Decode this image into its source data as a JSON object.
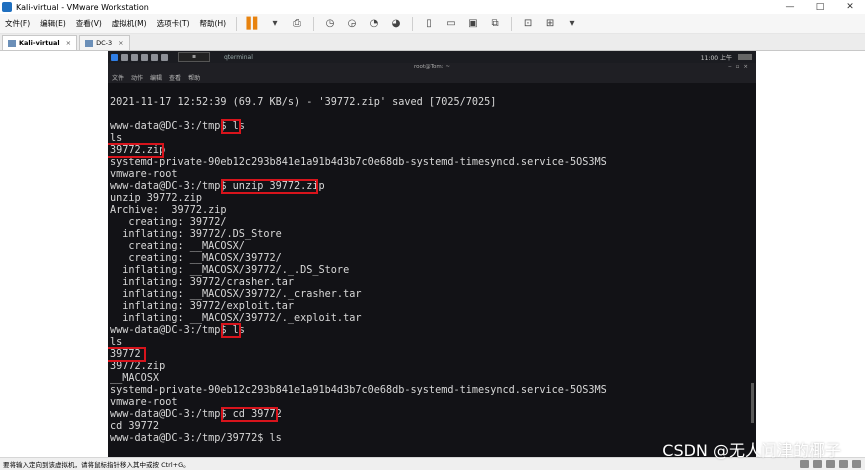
{
  "window": {
    "title": "Kali-virtual - VMware Workstation",
    "controls": [
      "—",
      "□",
      "✕"
    ]
  },
  "menubar": {
    "items": [
      "文件(F)",
      "编辑(E)",
      "查看(V)",
      "虚拟机(M)",
      "选项卡(T)",
      "帮助(H)"
    ]
  },
  "tabs": [
    {
      "label": "Kali-virtual",
      "active": true
    },
    {
      "label": "DC-3",
      "active": false
    }
  ],
  "guest": {
    "panel": {
      "terminal_tab": "qterminal",
      "clock": "11:00 上午"
    },
    "terminal_title": "root@Tom: ~",
    "terminal_menu": [
      "文件",
      "动作",
      "编辑",
      "查看",
      "帮助"
    ],
    "lines": [
      "2021-11-17 12:52:39 (69.7 KB/s) - '39772.zip' saved [7025/7025]",
      "",
      "www-data@DC-3:/tmp$ ls",
      "ls",
      "39772.zip",
      "systemd-private-90eb12c293b841e1a91b4d3b7c0e68db-systemd-timesyncd.service-5OS3MS",
      "vmware-root",
      "www-data@DC-3:/tmp$ unzip 39772.zip",
      "unzip 39772.zip",
      "Archive:  39772.zip",
      "   creating: 39772/",
      "  inflating: 39772/.DS_Store",
      "   creating: __MACOSX/",
      "   creating: __MACOSX/39772/",
      "  inflating: __MACOSX/39772/._.DS_Store",
      "  inflating: 39772/crasher.tar",
      "  inflating: __MACOSX/39772/._crasher.tar",
      "  inflating: 39772/exploit.tar",
      "  inflating: __MACOSX/39772/._exploit.tar",
      "www-data@DC-3:/tmp$ ls",
      "ls",
      "39772",
      "39772.zip",
      "__MACOSX",
      "systemd-private-90eb12c293b841e1a91b4d3b7c0e68db-systemd-timesyncd.service-5OS3MS",
      "vmware-root",
      "www-data@DC-3:/tmp$ cd 39772",
      "cd 39772",
      "www-data@DC-3:/tmp/39772$ ls"
    ]
  },
  "statusbar": {
    "text": "要将输入定向到该虚拟机，请将鼠标指针移入其中或按 Ctrl+G。"
  },
  "watermark": "CSDN @无人问津的椰子",
  "colors": {
    "terminal_bg": "#121216",
    "terminal_text": "#d8d8d8",
    "highlight_border": "#d8141c",
    "pause_icon": "#e8830f"
  }
}
